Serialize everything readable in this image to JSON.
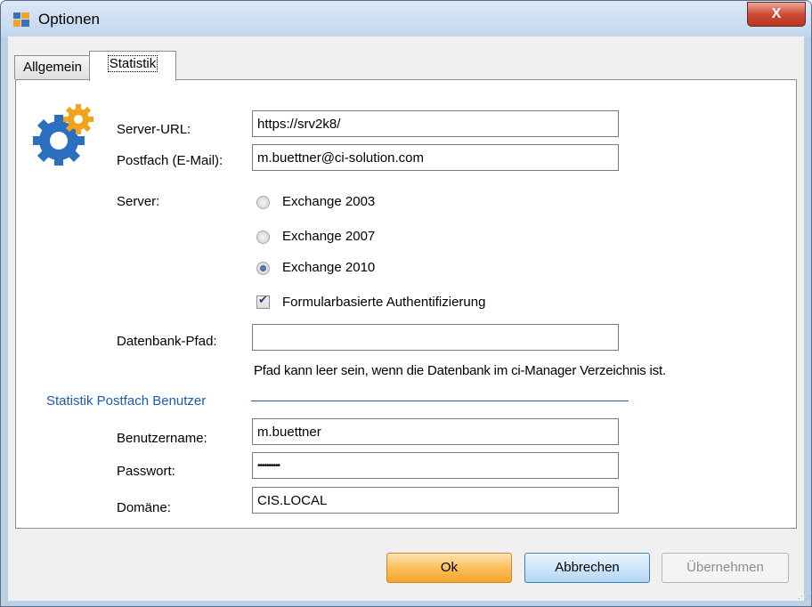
{
  "window": {
    "title": "Optionen",
    "close_label": "X"
  },
  "tabs": [
    {
      "label": "Allgemein"
    },
    {
      "label": "Statistik"
    }
  ],
  "form": {
    "server_url": {
      "label": "Server-URL:",
      "value": "https://srv2k8/"
    },
    "postfach": {
      "label": "Postfach (E-Mail):",
      "value": "m.buettner@ci-solution.com"
    },
    "server": {
      "label": "Server:",
      "options": [
        "Exchange 2003",
        "Exchange 2007",
        "Exchange 2010"
      ],
      "selected": "Exchange 2010"
    },
    "forms_auth": {
      "label": "Formularbasierte Authentifizierung",
      "checked": true
    },
    "datenbank": {
      "label": "Datenbank-Pfad:",
      "value": "",
      "hint": "Pfad kann leer sein, wenn die Datenbank im ci-Manager Verzeichnis ist."
    }
  },
  "stat_group": {
    "title": "Statistik Postfach Benutzer",
    "benutzername": {
      "label": "Benutzername:",
      "value": "m.buettner"
    },
    "passwort": {
      "label": "Passwort:",
      "value": "••••••••••"
    },
    "domaene": {
      "label": "Domäne:",
      "value": "CIS.LOCAL"
    }
  },
  "buttons": {
    "ok": "Ok",
    "cancel": "Abbrechen",
    "apply": "Übernehmen"
  },
  "icons": {
    "app": "options-window-icon",
    "settings": "gear-icon"
  },
  "colors": {
    "group_title": "#1e5aa8",
    "ok_button": "#fbbf5c",
    "cancel_button": "#cde6fa",
    "close_button": "#cf4a36"
  }
}
